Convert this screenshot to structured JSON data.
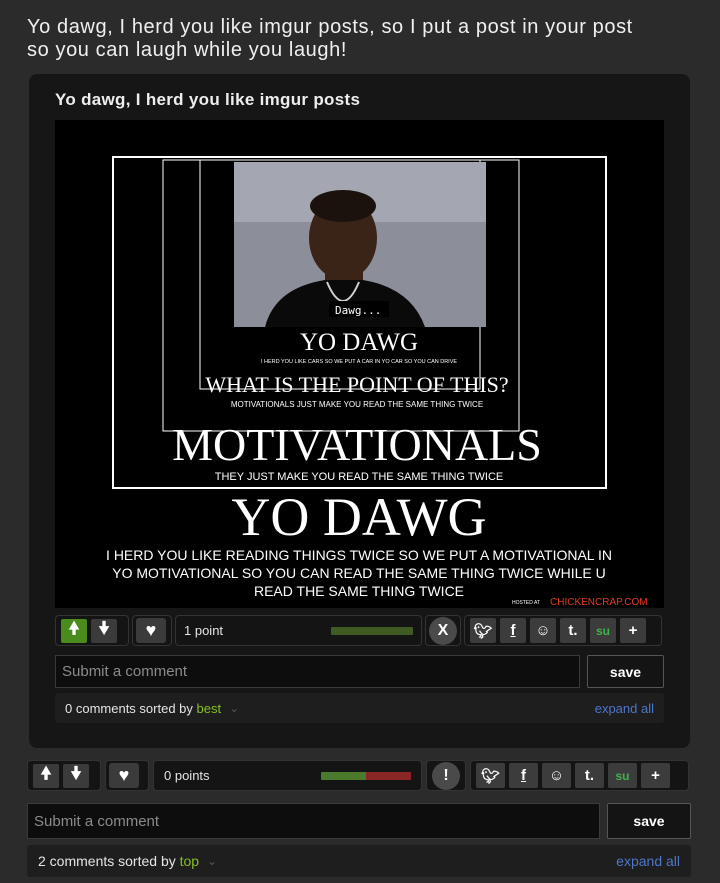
{
  "post": {
    "title": "Yo dawg, I herd you like imgur posts, so I put a post in your post\nso you can laugh while you laugh!",
    "points": "0 points",
    "comments_count": "2 comments sorted by",
    "sort": "top",
    "expand_label": "expand all",
    "comment_placeholder": "Submit a comment",
    "save_label": "save",
    "meter_colors": {
      "up": "#4b7a2a",
      "down": "#8b2626"
    },
    "meter_fraction_up": 0.5
  },
  "embedded": {
    "title": "Yo dawg, I herd you like imgur posts",
    "points": "1 point",
    "comments_count": "0 comments sorted by",
    "sort": "best",
    "expand_label": "expand all",
    "comment_placeholder": "Submit a comment",
    "save_label": "save",
    "meter_colors": {
      "up": "#3f5a22"
    },
    "meter_fraction_up": 1
  },
  "image": {
    "bubble": "Dawg...",
    "inner_title": "YO DAWG",
    "inner_sub": "I HERD YOU LIKE CARS SO WE PUT A CAR IN YO CAR SO YOU CAN DRIVE",
    "mid_title": "WHAT IS THE POINT OF THIS?",
    "mid_sub": "MOTIVATIONALS JUST MAKE YOU READ THE SAME THING TWICE",
    "big_title": "MOTIVATIONALS",
    "big_sub": "THEY JUST MAKE YOU READ THE SAME THING TWICE",
    "outer_title": "YO DAWG",
    "outer_sub_1": "I HERD YOU LIKE READING THINGS TWICE SO WE PUT A MOTIVATIONAL IN",
    "outer_sub_2": "YO MOTIVATIONAL SO YOU CAN READ THE SAME THING TWICE WHILE U",
    "outer_sub_3": "READ THE SAME THING TWICE",
    "hosted": "HOSTED AT",
    "site": "CHICKENCRAP.COM"
  },
  "icons": {
    "upvote": "arrow-up-icon",
    "downvote": "arrow-down-icon",
    "favorite": "heart-icon",
    "close": "x-icon",
    "report": "exclamation-icon",
    "twitter": "twitter-icon",
    "facebook": "facebook-icon",
    "reddit": "reddit-icon",
    "tumblr": "tumblr-icon",
    "stumbleupon": "stumbleupon-icon",
    "more": "plus-icon"
  },
  "share_glyphs": {
    "facebook": "f",
    "tumblr": "t.",
    "stumbleupon": "su",
    "more": "+",
    "close": "X",
    "report": "!"
  }
}
